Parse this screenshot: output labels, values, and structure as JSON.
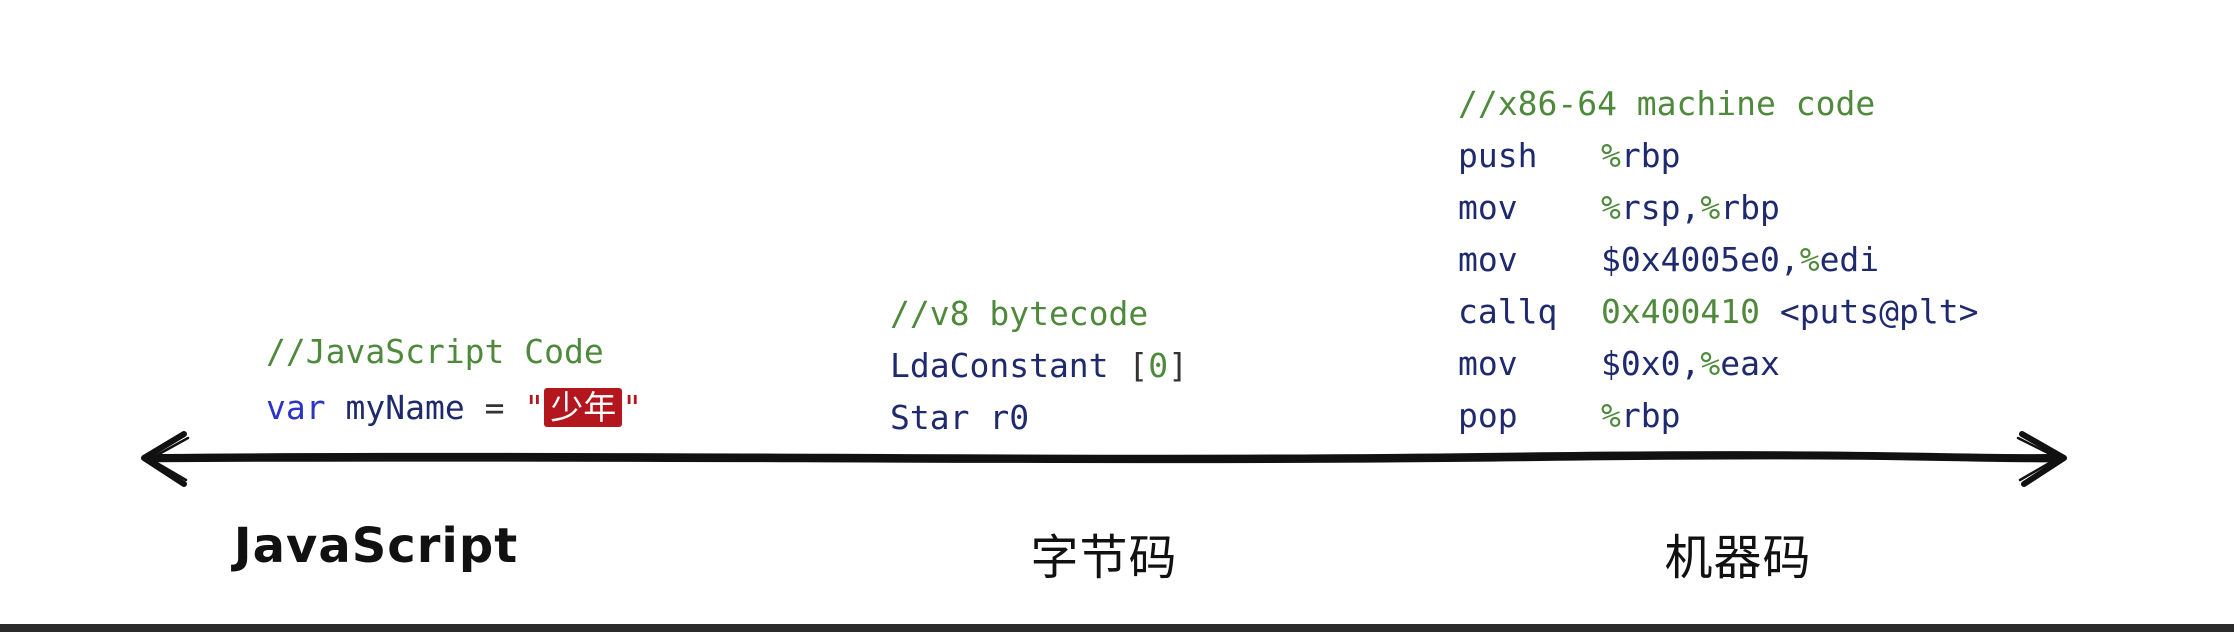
{
  "javascript_code": {
    "comment": "//JavaScript Code",
    "keyword": "var",
    "identifier": "myName",
    "operator": "=",
    "string_quote_open": "\"",
    "string_value": "少年",
    "string_quote_close": "\""
  },
  "bytecode": {
    "comment": "//v8 bytecode",
    "line1_op": "LdaConstant",
    "line1_open": "[",
    "line1_num": "0",
    "line1_close": "]",
    "line2": "Star r0"
  },
  "machine_code": {
    "comment": "//x86-64 machine code",
    "instructions": [
      {
        "op": "push",
        "pct1": "%",
        "arg1": "rbp",
        "rest": ""
      },
      {
        "op": "mov",
        "pct1": "%",
        "arg1": "rsp,",
        "pct2": "%",
        "arg2": "rbp"
      },
      {
        "op": "mov",
        "pct1": "",
        "arg1": "$0x4005e0,",
        "pct2": "%",
        "arg2": "edi"
      },
      {
        "op": "callq",
        "arg1": "0x400410",
        "arg2": " <puts@plt>"
      },
      {
        "op": "mov",
        "pct1": "",
        "arg1": "$0x0,",
        "pct2": "%",
        "arg2": "eax"
      },
      {
        "op": "pop",
        "pct1": "%",
        "arg1": "rbp",
        "rest": ""
      }
    ]
  },
  "axis": {
    "labels": [
      "JavaScript",
      "字节码",
      "机器码"
    ]
  },
  "colors": {
    "comment": "#4f8a3c",
    "keyword": "#2c34c8",
    "text": "#1f2a6e",
    "string": "#b3171d"
  }
}
